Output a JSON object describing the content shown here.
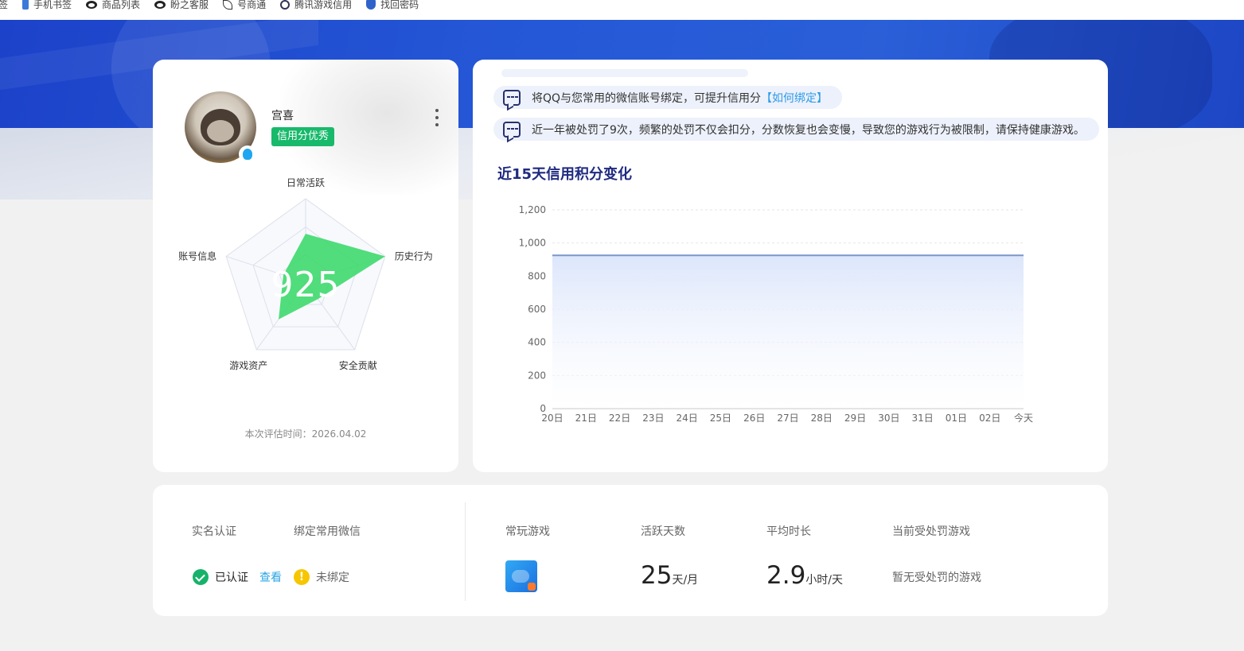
{
  "bookmarks": [
    {
      "label": "签",
      "icon": "bookmark-icon"
    },
    {
      "label": "手机书签",
      "icon": "phone-icon"
    },
    {
      "label": "商品列表",
      "icon": "panda-icon"
    },
    {
      "label": "盼之客服",
      "icon": "panda-icon"
    },
    {
      "label": "号商通",
      "icon": "leaf-icon"
    },
    {
      "label": "腾讯游戏信用",
      "icon": "globe-icon"
    },
    {
      "label": "找回密码",
      "icon": "shield-icon"
    }
  ],
  "profile": {
    "username": "宫喜",
    "credit_tag": "信用分优秀",
    "score": "925",
    "eval_time": "本次评估时间：2026.04.02",
    "radar": {
      "axes": [
        "日常活跃",
        "历史行为",
        "安全贡献",
        "游戏资产",
        "账号信息"
      ],
      "values": [
        0.58,
        1.0,
        0.25,
        0.55,
        0.28
      ],
      "color": "#3ed96e"
    }
  },
  "notices": [
    {
      "text": "将QQ与您常用的微信账号绑定，可提升信用分",
      "link": "【如何绑定】"
    },
    {
      "text": "近一年被处罚了9次，频繁的处罚不仅会扣分，分数恢复也会变慢，导致您的游戏行为被限制，请保持健康游戏。",
      "link": ""
    }
  ],
  "chart_title": "近15天信用积分变化",
  "chart_data": {
    "type": "area",
    "title": "近15天信用积分变化",
    "categories": [
      "20日",
      "21日",
      "22日",
      "23日",
      "24日",
      "25日",
      "26日",
      "27日",
      "28日",
      "29日",
      "30日",
      "31日",
      "01日",
      "02日",
      "今天"
    ],
    "values": [
      925,
      925,
      925,
      925,
      925,
      925,
      925,
      925,
      925,
      925,
      925,
      925,
      925,
      925,
      925
    ],
    "ylim": [
      0,
      1200
    ],
    "yticks": [
      "0",
      "200",
      "400",
      "600",
      "800",
      "1,000",
      "1,200"
    ],
    "grid": true,
    "line_color": "#7a96c8",
    "fill_color": "#dfe8fb"
  },
  "stats": {
    "realname_label": "实名认证",
    "wechat_label": "绑定常用微信",
    "realname_status": "已认证",
    "realname_view": "查看",
    "wechat_status": "未绑定",
    "fav_games_label": "常玩游戏",
    "active_days_label": "活跃天数",
    "active_days": "25",
    "active_days_unit": "天/月",
    "avg_time_label": "平均时长",
    "avg_time": "2.9",
    "avg_time_unit": "小时/天",
    "punished_label": "当前受处罚游戏",
    "punished_value": "暂无受处罚的游戏",
    "warn_symbol": "!"
  }
}
